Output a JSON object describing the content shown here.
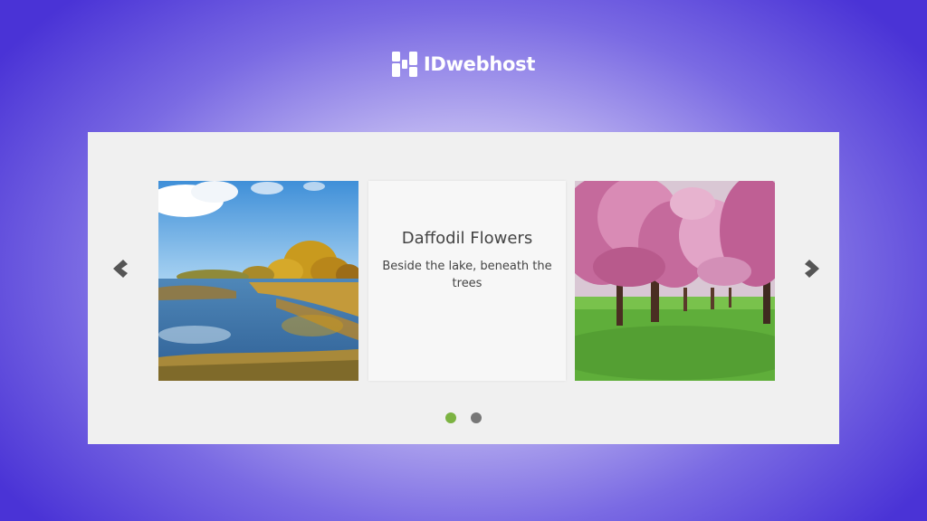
{
  "brand": {
    "name": "IDwebhost",
    "logo_icon": "idwebhost-logo-icon"
  },
  "slider": {
    "prev_icon": "chevron-left-icon",
    "next_icon": "chevron-right-icon",
    "slides": [
      {
        "image": "autumn-lake-photo"
      },
      {
        "title": "Daffodil Flowers",
        "text": "Beside the lake, beneath the trees"
      },
      {
        "image": "cherry-blossom-trees-photo"
      }
    ],
    "page_count": 2,
    "active_page": 1,
    "colors": {
      "active_dot": "#7cb342",
      "inactive_dot": "#777777",
      "arrow": "#555555"
    }
  }
}
